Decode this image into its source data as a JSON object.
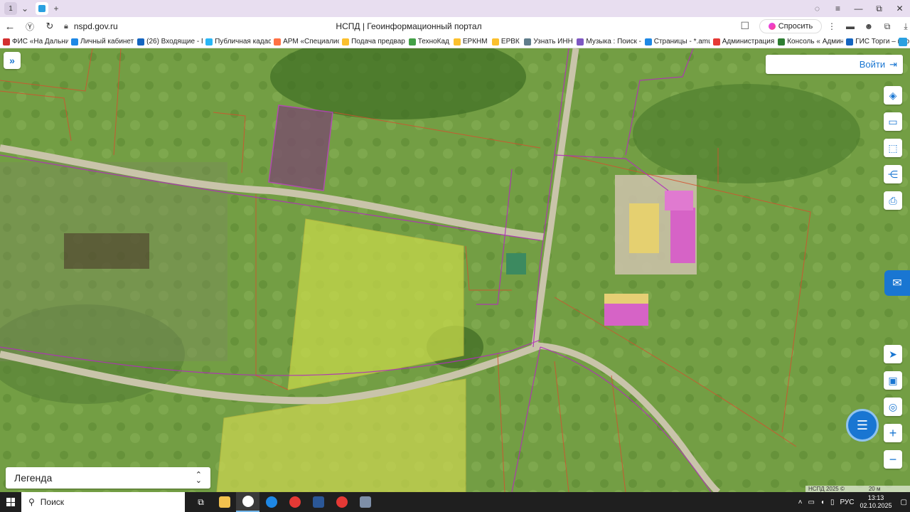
{
  "browser": {
    "tab_count": "1",
    "url": "nspd.gov.ru",
    "page_title": "НСПД | Геоинформационный портал",
    "ask_label": "Спросить"
  },
  "bookmarks": [
    {
      "label": "ФИС «На Дальни",
      "color": "#d32f2f"
    },
    {
      "label": "Личный кабинет",
      "color": "#1e88e5"
    },
    {
      "label": "(26) Входящие - Г",
      "color": "#1565c0"
    },
    {
      "label": "Публичная кадас",
      "color": "#29b6f6"
    },
    {
      "label": "АРМ «Специалис",
      "color": "#ff7043"
    },
    {
      "label": "Подача предвар",
      "color": "#fbc02d"
    },
    {
      "label": "ТехноКад",
      "color": "#43a047"
    },
    {
      "label": "ЕРКНМ",
      "color": "#fbc02d"
    },
    {
      "label": "ЕРВК",
      "color": "#fbc02d"
    },
    {
      "label": "Узнать ИНН",
      "color": "#607d8b"
    },
    {
      "label": "Музыка : Поиск -",
      "color": "#7e57c2"
    },
    {
      "label": "Страницы - *.amu",
      "color": "#1e88e5"
    },
    {
      "label": "Администрация",
      "color": "#e53935"
    },
    {
      "label": "Консоль « Админ",
      "color": "#2e7d32"
    },
    {
      "label": "ГИС Торги – про",
      "color": "#1565c0"
    }
  ],
  "map": {
    "login_label": "Войти",
    "legend_label": "Легенда",
    "attribution": "НСПД 2025 ©",
    "scale_label": "20 м"
  },
  "taskbar": {
    "search_placeholder": "Поиск",
    "language": "РУС",
    "time": "13:13",
    "date": "02.10.2025"
  }
}
